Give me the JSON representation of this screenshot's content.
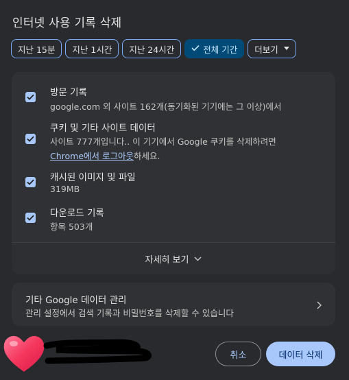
{
  "dialog": {
    "title": "인터넷 사용 기록 삭제"
  },
  "time_ranges": [
    {
      "label": "지난 15분",
      "selected": false
    },
    {
      "label": "지난 1시간",
      "selected": false
    },
    {
      "label": "지난 24시간",
      "selected": false
    },
    {
      "label": "전체 기간",
      "selected": true
    },
    {
      "label": "더보기",
      "selected": false
    }
  ],
  "items": [
    {
      "title": "방문 기록",
      "desc": "google.com 외 사이트 162개(동기화된 기기에는 그 이상)에서",
      "checked": true
    },
    {
      "title": "쿠키 및 기타 사이트 데이터",
      "desc": "사이트 777개입니다.. 이 기기에서 Google 쿠키를 삭제하려면",
      "desc_link": "Chrome에서 로그아웃",
      "desc_suffix": "하세요.",
      "checked": true
    },
    {
      "title": "캐시된 이미지 및 파일",
      "desc": "319MB",
      "checked": true
    },
    {
      "title": "다운로드 기록",
      "desc": "항목 503개",
      "checked": true
    }
  ],
  "more_details": {
    "label": "자세히 보기"
  },
  "google_data": {
    "title": "기타 Google 데이터 관리",
    "desc": "관리 설정에서 검색 기록과 비밀번호를 삭제할 수 있습니다"
  },
  "buttons": {
    "cancel": "취소",
    "delete": "데이터 삭제"
  },
  "colors": {
    "background": "#282a2d",
    "card": "#303134",
    "accent": "#a8c7fa",
    "selected_chip": "#004a77"
  },
  "icons": {
    "check": "check-icon",
    "caret": "caret-down-icon",
    "chevron_down": "chevron-down-icon",
    "chevron_right": "chevron-right-icon",
    "avatar": "heart-avatar-icon"
  }
}
